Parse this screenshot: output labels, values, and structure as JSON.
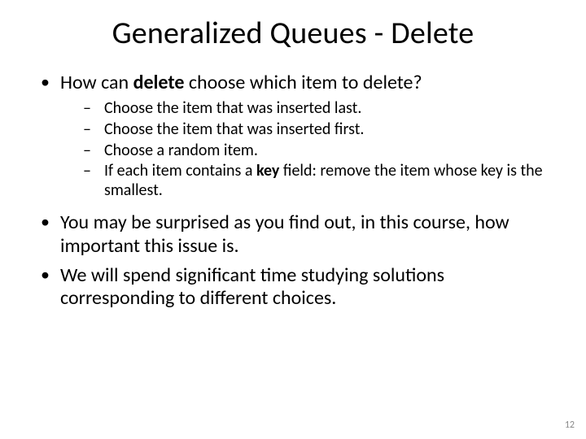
{
  "title": "Generalized Queues - Delete",
  "bullets": {
    "b1_pre": "How can ",
    "b1_bold": "delete",
    "b1_post": " choose which item to delete?",
    "sub": [
      "Choose the item that was inserted last.",
      "Choose the item that was inserted first.",
      "Choose a random item."
    ],
    "sub4_pre": "If each item contains a ",
    "sub4_bold": "key",
    "sub4_post": " field: remove the item whose key is the smallest.",
    "b2": "You may be surprised as you find out, in this course, how important this issue is.",
    "b3": "We will spend significant time studying solutions corresponding to different choices."
  },
  "page_number": "12"
}
